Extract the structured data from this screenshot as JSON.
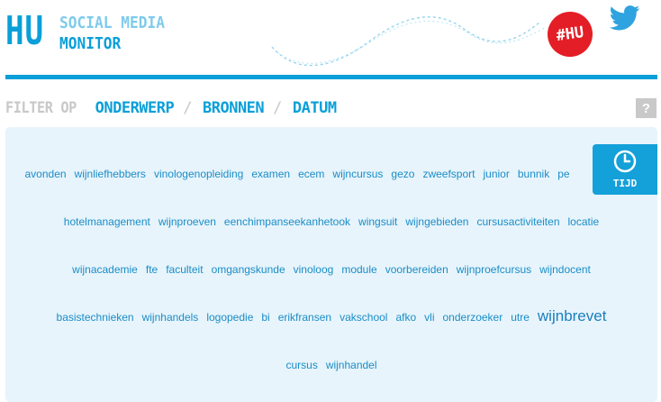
{
  "header": {
    "logo_mark": "HU",
    "logo_line1": "SOCIAL MEDIA",
    "logo_line2": "MONITOR",
    "badge_text": "#HU",
    "icons": {
      "badge": "hashtag-hu-badge",
      "bird": "twitter-bird-icon",
      "wave": "dotted-wave-decoration"
    }
  },
  "filter": {
    "label": "FILTER OP",
    "links": [
      "ONDERWERP",
      "BRONNEN",
      "DATUM"
    ],
    "separator": "/",
    "help": "?"
  },
  "tijd": {
    "label": "TIJD",
    "icon": "clock-icon"
  },
  "word_cloud": {
    "rows": [
      [
        "avonden",
        "wijnliefhebbers",
        "vinologenopleiding",
        "examen",
        "ecem",
        "wijncursus",
        "gezo",
        "zweefsport",
        "junior",
        "bunnik",
        "pe"
      ],
      [
        "hotelmanagement",
        "wijnproeven",
        "eenchimpanseekanhetook",
        "wingsuit",
        "wijngebieden",
        "cursusactiviteiten",
        "locatie"
      ],
      [
        "wijnacademie",
        "fte",
        "faculteit",
        "omgangskunde",
        "vinoloog",
        "module",
        "voorbereiden",
        "wijnproefcursus",
        "wijndocent"
      ],
      [
        "basistechnieken",
        "wijnhandels",
        "logopedie",
        "bi",
        "erikfransen",
        "vakschool",
        "afko",
        "vli",
        "onderzoeker",
        "utre",
        "wijnbrevet"
      ],
      [
        "cursus",
        "wijnhandel"
      ]
    ],
    "emphasized": "wijnbrevet"
  },
  "colors": {
    "brand_blue": "#0a9fd9",
    "light_blue": "#7fcbeb",
    "badge_red": "#e41e26",
    "panel_bg": "#e7f4fb",
    "muted_gray": "#c8c8c8"
  }
}
